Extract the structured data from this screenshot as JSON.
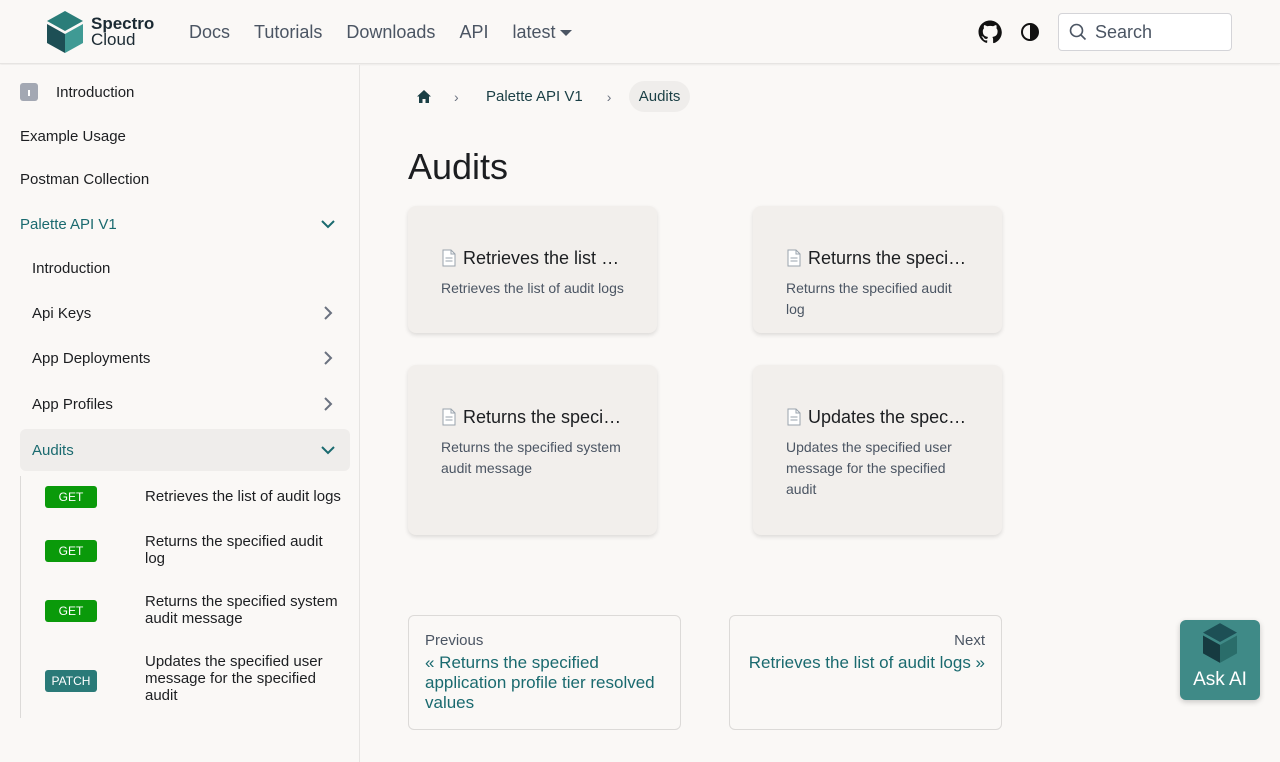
{
  "navbar": {
    "logo_line1": "Spectro",
    "logo_line2": "Cloud",
    "links": [
      "Docs",
      "Tutorials",
      "Downloads",
      "API"
    ],
    "version_label": "latest",
    "search_placeholder": "Search"
  },
  "sidebar": {
    "items": [
      {
        "label": "Introduction"
      },
      {
        "label": "Example Usage"
      },
      {
        "label": "Postman Collection"
      },
      {
        "label": "Palette API V1"
      },
      {
        "label": "Introduction"
      },
      {
        "label": "Api Keys"
      },
      {
        "label": "App Deployments"
      },
      {
        "label": "App Profiles"
      },
      {
        "label": "Audits"
      }
    ],
    "endpoints": [
      {
        "method": "GET",
        "label": "Retrieves the list of audit logs"
      },
      {
        "method": "GET",
        "label": "Returns the specified audit log"
      },
      {
        "method": "GET",
        "label": "Returns the specified system audit message"
      },
      {
        "method": "PATCH",
        "label": "Updates the specified user message for the specified audit"
      }
    ]
  },
  "breadcrumb": {
    "parent": "Palette API V1",
    "current": "Audits"
  },
  "page": {
    "title": "Audits",
    "cards": [
      {
        "title": "Retrieves the list of audit logs",
        "desc": "Retrieves the list of audit logs"
      },
      {
        "title": "Returns the specified audit log",
        "desc": "Returns the specified audit log"
      },
      {
        "title": "Returns the specified system audit message",
        "desc": "Returns the specified system audit message"
      },
      {
        "title": "Updates the specified user message for the specified audit",
        "desc": "Updates the specified user message for the specified audit"
      }
    ]
  },
  "pager": {
    "prev_sub": "Previous",
    "prev_label": "« Returns the specified application profile tier resolved values",
    "next_sub": "Next",
    "next_label": "Retrieves the list of audit logs »"
  },
  "ask_ai": {
    "label": "Ask AI"
  },
  "colors": {
    "brand": "#1a6a6f",
    "get_badge": "#0a9a0a",
    "patch_badge": "#2a7a78",
    "ask_ai_bg": "#3f8a87"
  }
}
